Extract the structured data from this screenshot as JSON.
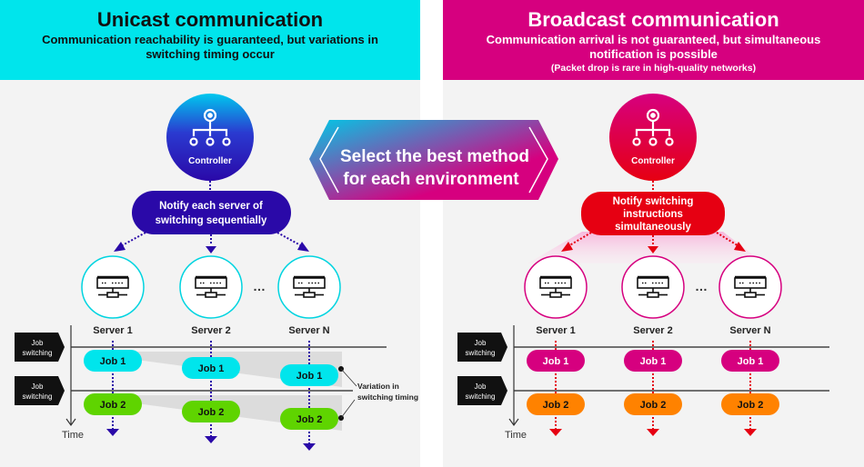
{
  "unicast": {
    "title": "Unicast communication",
    "subtitle": "Communication reachability is guaranteed, but variations in switching timing occur",
    "controller_label": "Controller",
    "notify_label_line1": "Notify each server of",
    "notify_label_line2": "switching sequentially",
    "servers": [
      "Server 1",
      "Server 2",
      "Server N"
    ],
    "ellipsis": "…",
    "job_switching_line1": "Job",
    "job_switching_line2": "switching",
    "time_label": "Time",
    "jobs": [
      "Job 1",
      "Job 2"
    ],
    "variation_line1": "Variation  in",
    "variation_line2": "switching  timing",
    "colors": {
      "header": "#00e5ec",
      "accent": "#2a09a8",
      "job1": "#00e5ec",
      "job2": "#5fd400",
      "server_ring": "#00d4e0"
    }
  },
  "broadcast": {
    "title": "Broadcast communication",
    "subtitle_line1": "Communication arrival is not guaranteed, but simultaneous",
    "subtitle_line2": "notification is possible",
    "note": "(Packet drop is rare in high-quality networks)",
    "controller_label": "Controller",
    "notify_label_line1": "Notify switching",
    "notify_label_line2": "instructions",
    "notify_label_line3": "simultaneously",
    "servers": [
      "Server 1",
      "Server 2",
      "Server N"
    ],
    "ellipsis": "…",
    "job_switching_line1": "Job",
    "job_switching_line2": "switching",
    "time_label": "Time",
    "jobs": [
      "Job 1",
      "Job 2"
    ],
    "colors": {
      "header": "#d6007f",
      "accent": "#e60012",
      "job1": "#d6007f",
      "job2": "#ff8200",
      "server_ring": "#d6007f"
    }
  },
  "center": {
    "line1": "Select the best method",
    "line2": "for each environment"
  }
}
